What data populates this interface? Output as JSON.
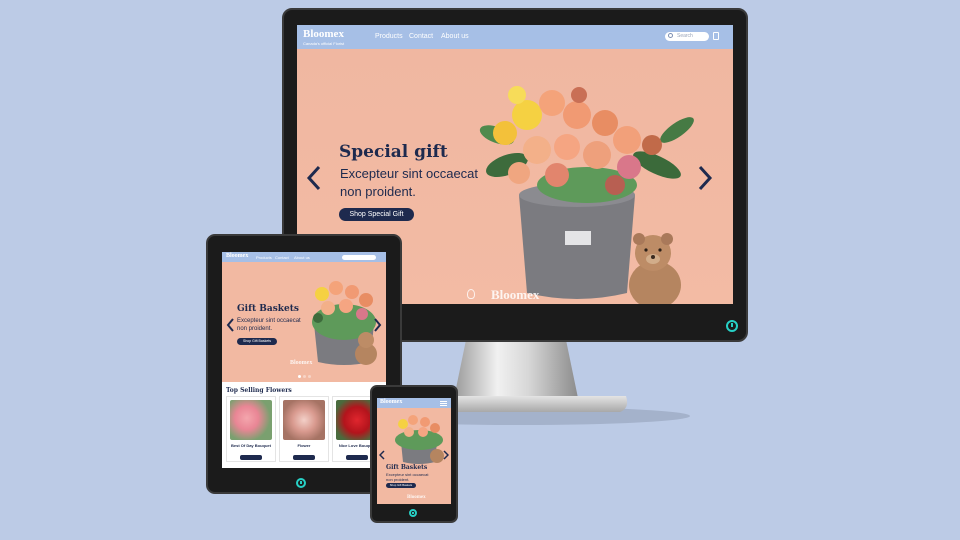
{
  "site": {
    "logo": "Bloomex",
    "tagline": "Canada's official Florist",
    "nav": [
      "Products",
      "Contact",
      "About us"
    ],
    "search_placeholder": "Search",
    "brand_watermark": "Bloomex"
  },
  "desktop": {
    "hero_title": "Special gift",
    "hero_text_1": "Excepteur sint occaecat",
    "hero_text_2": "non proident.",
    "hero_button": "Shop Special Gift"
  },
  "tablet": {
    "hero_title": "Gift Baskets",
    "hero_text_1": "Excepteur sint occaecat",
    "hero_text_2": "non proident.",
    "hero_button": "Shop Gift Baskets",
    "section_title": "Top Selling Flowers",
    "products": [
      {
        "name": "Best Of Day Bouquet"
      },
      {
        "name": "Flower"
      },
      {
        "name": "Nice Love Bouquet"
      }
    ]
  },
  "phone": {
    "hero_title": "Gift Baskets",
    "hero_text_1": "Excepteur sint occaecat",
    "hero_text_2": "non proident.",
    "hero_button": "Shop Gift Baskets"
  },
  "colors": {
    "background": "#bccbe6",
    "header": "#a6bfe6",
    "hero": "#f2b9a2",
    "navy": "#1e2a4e",
    "power": "#27d0c5"
  }
}
